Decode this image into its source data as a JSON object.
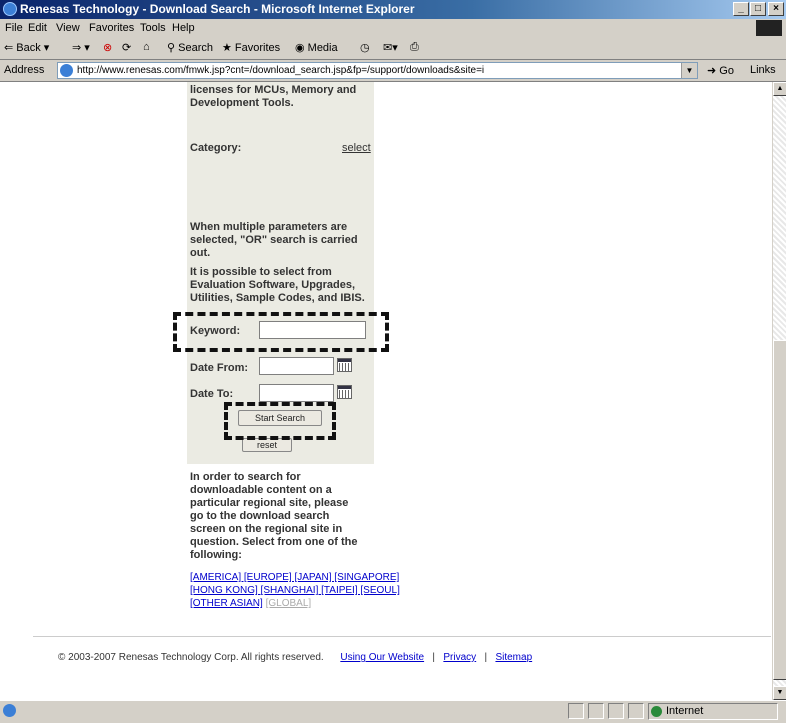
{
  "window": {
    "title": "Renesas Technology - Download Search - Microsoft Internet Explorer"
  },
  "menu": [
    "File",
    "Edit",
    "View",
    "Favorites",
    "Tools",
    "Help"
  ],
  "toolbar": {
    "back": "Back",
    "search": "Search",
    "favorites": "Favorites",
    "media": "Media"
  },
  "address": {
    "label": "Address",
    "url": "http://www.renesas.com/fmwk.jsp?cnt=/download_search.jsp&fp=/support/downloads&site=i",
    "go": "Go",
    "links": "Links"
  },
  "panel": {
    "intro_line1": "licenses for MCUs, Memory and",
    "intro_line2": "Development Tools.",
    "category_label": "Category:",
    "category_select": "select",
    "note1": [
      "When multiple parameters are",
      "selected, \"OR\" search is carried",
      "out."
    ],
    "note2": [
      "It is possible to select from",
      "Evaluation Software, Upgrades,",
      "Utilities, Sample Codes, and IBIS."
    ],
    "keyword_label": "Keyword:",
    "keyword_value": "",
    "date_from_label": "Date From:",
    "date_to_label": "Date To:",
    "start_search": "Start Search",
    "reset": "reset"
  },
  "regional": {
    "text": [
      "In order to search for",
      "downloadable content on a",
      "particular regional site, please",
      "go to the download search",
      "screen on the regional site in",
      "question. Select from one of the",
      "following:"
    ],
    "row1": "[AMERICA] [EUROPE] [JAPAN] [SINGAPORE]",
    "row2": "[HONG KONG] [SHANGHAI] [TAIPEI] [SEOUL]",
    "row3_link": "[OTHER ASIAN]",
    "row3_current": "[GLOBAL]"
  },
  "footer": {
    "copyright": "© 2003-2007 Renesas Technology Corp. All rights reserved.",
    "link1": "Using Our Website",
    "link2": "Privacy",
    "link3": "Sitemap"
  },
  "status": {
    "zone": "Internet"
  }
}
